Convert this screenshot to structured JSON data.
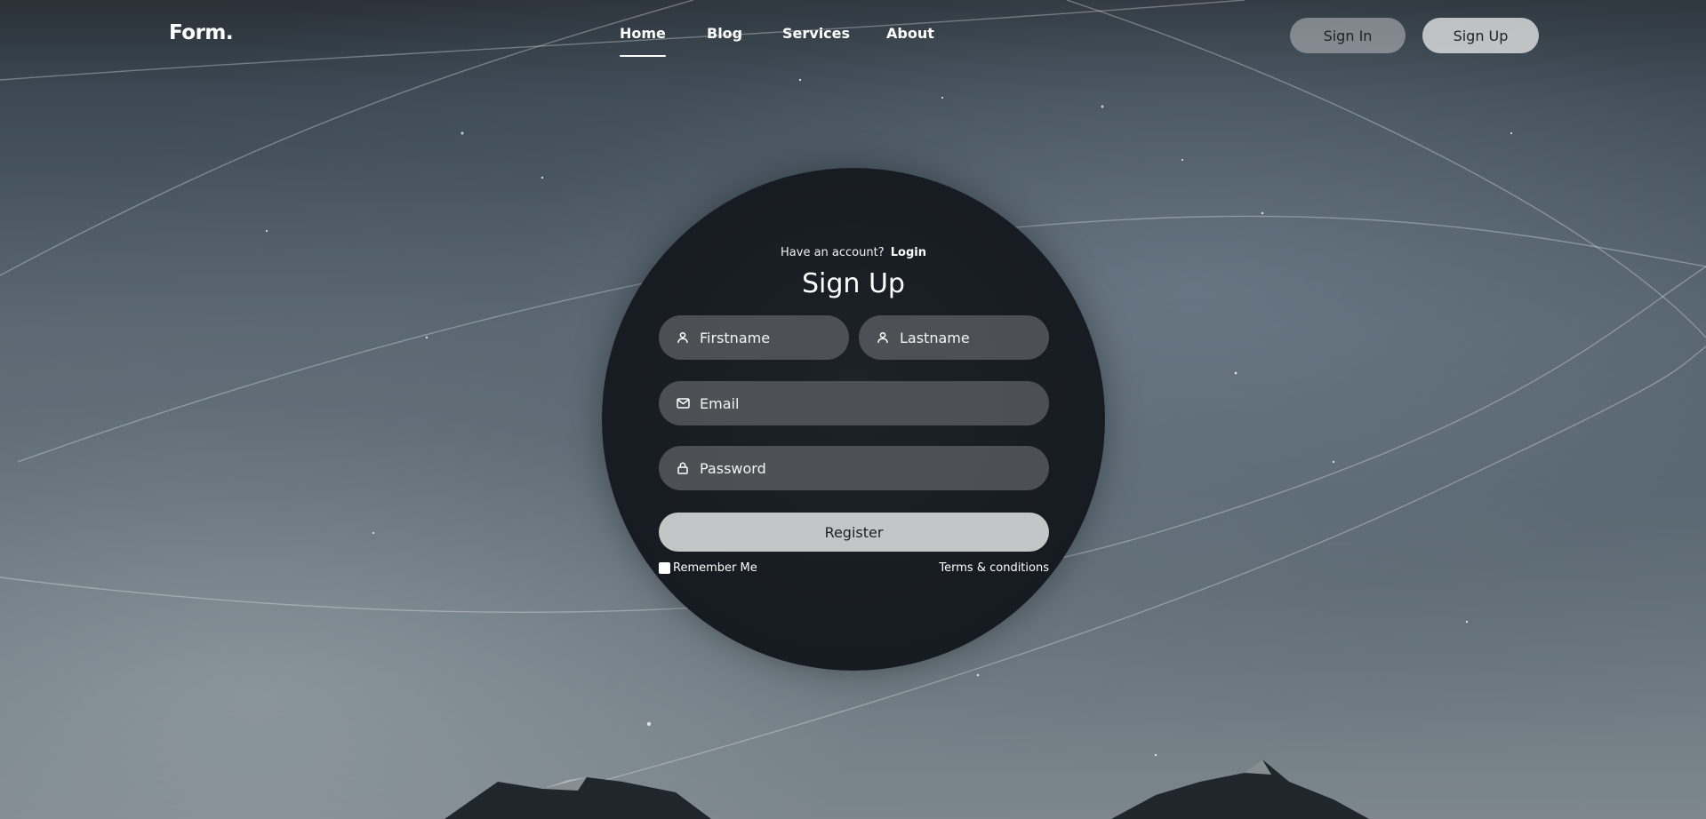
{
  "brand": {
    "logo": "Form."
  },
  "nav": {
    "links": [
      {
        "label": "Home",
        "active": true
      },
      {
        "label": "Blog",
        "active": false
      },
      {
        "label": "Services",
        "active": false
      },
      {
        "label": "About",
        "active": false
      }
    ],
    "signin_label": "Sign In",
    "signup_label": "Sign Up"
  },
  "form": {
    "have_account_text": "Have an account?",
    "login_link": "Login",
    "title": "Sign Up",
    "firstname": {
      "placeholder": "Firstname",
      "value": "",
      "icon": "user-icon"
    },
    "lastname": {
      "placeholder": "Lastname",
      "value": "",
      "icon": "user-icon"
    },
    "email": {
      "placeholder": "Email",
      "value": "",
      "icon": "envelope-icon"
    },
    "password": {
      "placeholder": "Password",
      "value": "",
      "icon": "lock-icon"
    },
    "register_label": "Register",
    "remember_label": "Remember Me",
    "remember_checked": false,
    "terms_label": "Terms & conditions"
  },
  "colors": {
    "accent_light": "#c4c5c7",
    "circle_bg": "#171c22",
    "field_bg": "#5a5c60"
  }
}
